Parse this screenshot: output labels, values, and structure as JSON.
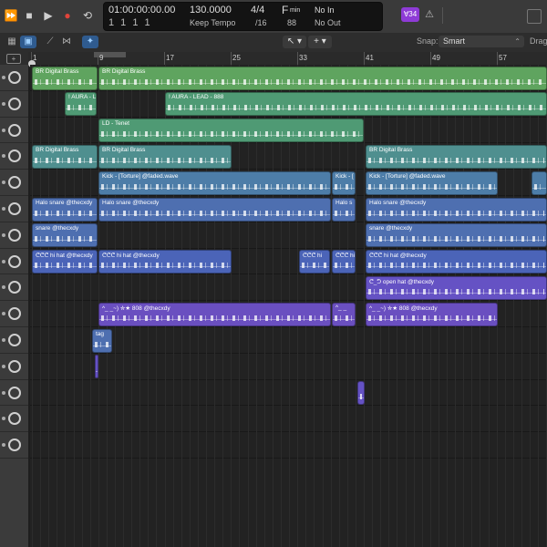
{
  "transport": {
    "position": "01:00:00:00.00",
    "bars": "1  1  1  1",
    "tempo": "130.0000",
    "tempo_mode": "Keep Tempo",
    "time_signature": "4/4",
    "division": "/16",
    "key": "F",
    "key_mode": "min",
    "key_value": "88",
    "midi_in": "No In",
    "midi_out": "No Out",
    "badge": "∀34",
    "icons": [
      "fast-forward-icon",
      "stop-icon",
      "play-icon",
      "record-icon",
      "cycle-icon"
    ]
  },
  "toolbar": {
    "snap_label": "Snap:",
    "snap_value": "Smart",
    "drag_label": "Drag",
    "pointer_tool": "↖",
    "secondary_tool": "+"
  },
  "ruler": {
    "markers": [
      "1",
      "9",
      "17",
      "25",
      "33",
      "41",
      "49",
      "57"
    ]
  },
  "tracks": [
    {
      "regions": [
        {
          "name": "BR Digital Brass",
          "color": "g1"
        },
        {
          "name": "BR Digital Brass",
          "color": "g1"
        }
      ]
    },
    {
      "regions": [
        {
          "name": "! AURA - L",
          "color": "g2"
        },
        {
          "name": "! AURA - LEAD - 888",
          "color": "g2"
        }
      ]
    },
    {
      "regions": [
        {
          "name": "LD - Tenet",
          "color": "g2"
        }
      ]
    },
    {
      "regions": [
        {
          "name": "BR Digital Brass",
          "color": "t1"
        },
        {
          "name": "BR Digital Brass",
          "color": "t1"
        },
        {
          "name": "BR Digital Brass",
          "color": "t1"
        }
      ]
    },
    {
      "regions": [
        {
          "name": "Kick - [Torture] @faded.wave",
          "color": "b1"
        },
        {
          "name": "Kick - [",
          "color": "b1"
        },
        {
          "name": "Kick - [Torture] @faded.wave",
          "color": "b1"
        },
        {
          "name": "",
          "color": "b1"
        }
      ]
    },
    {
      "regions": [
        {
          "name": "Halo snare @thecxdy",
          "color": "b2"
        },
        {
          "name": "Halo snare @thecxdy",
          "color": "b2"
        },
        {
          "name": "Halo s",
          "color": "b2"
        },
        {
          "name": "Halo snare @thecxdy",
          "color": "b2"
        }
      ]
    },
    {
      "regions": [
        {
          "name": "snare @thecxdy",
          "color": "b2"
        },
        {
          "name": "snare @thecxdy",
          "color": "b2"
        }
      ]
    },
    {
      "regions": [
        {
          "name": "ᕦᕦᕦ hi hat @thecxdy",
          "color": "b3"
        },
        {
          "name": "ᕦᕦᕦ hi hat @thecxdy",
          "color": "b3"
        },
        {
          "name": "ᕦᕦᕦ hi",
          "color": "b3"
        },
        {
          "name": "ᕦᕦᕦ hi",
          "color": "b3"
        },
        {
          "name": "ᕦᕦᕦ hi hat @thecxdy",
          "color": "b3"
        }
      ]
    },
    {
      "regions": [
        {
          "name": "ᕦ_ᕤ open hat @thecxdy",
          "color": "p1"
        }
      ]
    },
    {
      "regions": [
        {
          "name": "^_ _~) ✮★ 808 @thecxdy",
          "color": "p2"
        },
        {
          "name": "^_ _",
          "color": "p2"
        },
        {
          "name": "^_ _~) ✮★ 808 @thecxdy",
          "color": "p2"
        }
      ]
    },
    {
      "regions": [
        {
          "name": "tag",
          "color": "b2"
        }
      ]
    },
    {
      "regions": [
        {
          "name": "",
          "color": "p1"
        }
      ]
    },
    {
      "regions": [
        {
          "name": "",
          "color": "p1"
        }
      ]
    },
    {
      "regions": []
    },
    {
      "regions": []
    }
  ]
}
